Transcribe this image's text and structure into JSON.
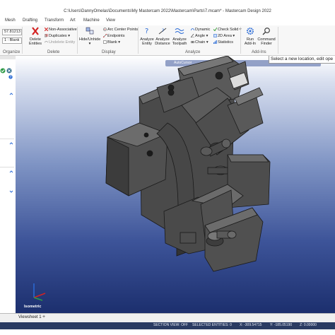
{
  "window": {
    "title": "C:\\Users\\DannyOmelas\\Documents\\My Mastercam 2022\\Mastercam\\Parts\\7.mcam* - Mastercam Design 2022"
  },
  "tabs": [
    "Mesh",
    "Drafting",
    "Transform",
    "Art",
    "Machine",
    "View"
  ],
  "ribbon": {
    "organize": {
      "level_value": "57.81213",
      "level_name": "1 : Blank",
      "label": "Organize"
    },
    "delete": {
      "delete_entities": "Delete Entities",
      "non_associative": "Non-Associative",
      "duplicates": "Duplicates",
      "undelete": "Undelete Entity",
      "label": "Delete"
    },
    "display": {
      "hide_unhide": "Hide/Unhide",
      "arc_center_points": "Arc Center Points",
      "endpoints": "Endpoints",
      "blank": "Blank",
      "label": "Display"
    },
    "analyze": {
      "analyze_entity": "Analyze Entity",
      "analyze_distance": "Analyze Distance",
      "analyze_toolpath": "Analyze Toolpath",
      "dynamic": "Dynamic",
      "angle": "Angle",
      "chain": "Chain",
      "check_solid": "Check Solid",
      "area_2d": "2D Area",
      "statistics": "Statistics",
      "label": "Analyze"
    },
    "addins": {
      "run_addin": "Run Add-In",
      "command_finder": "Command Finder",
      "label": "Add-Ins"
    }
  },
  "viewport": {
    "tooltip": "Select a new location, edit ope",
    "autocursor": "AutoCursor",
    "view_name": "Isometric"
  },
  "sheet": {
    "tab": "Viewsheet 1",
    "add": "+"
  },
  "status": {
    "section_view": "SECTION VIEW: OFF",
    "selected": "SELECTED ENTITIES: 0",
    "x": "X:  -309.54715",
    "y": "Y:  -185.05190",
    "z": "Z:  0.00000"
  },
  "colors": {
    "status_bg": "#2a3b62",
    "viewport_top": "#ffffff",
    "viewport_bottom": "#1c2f6e",
    "accent": "#2a6bd6"
  }
}
